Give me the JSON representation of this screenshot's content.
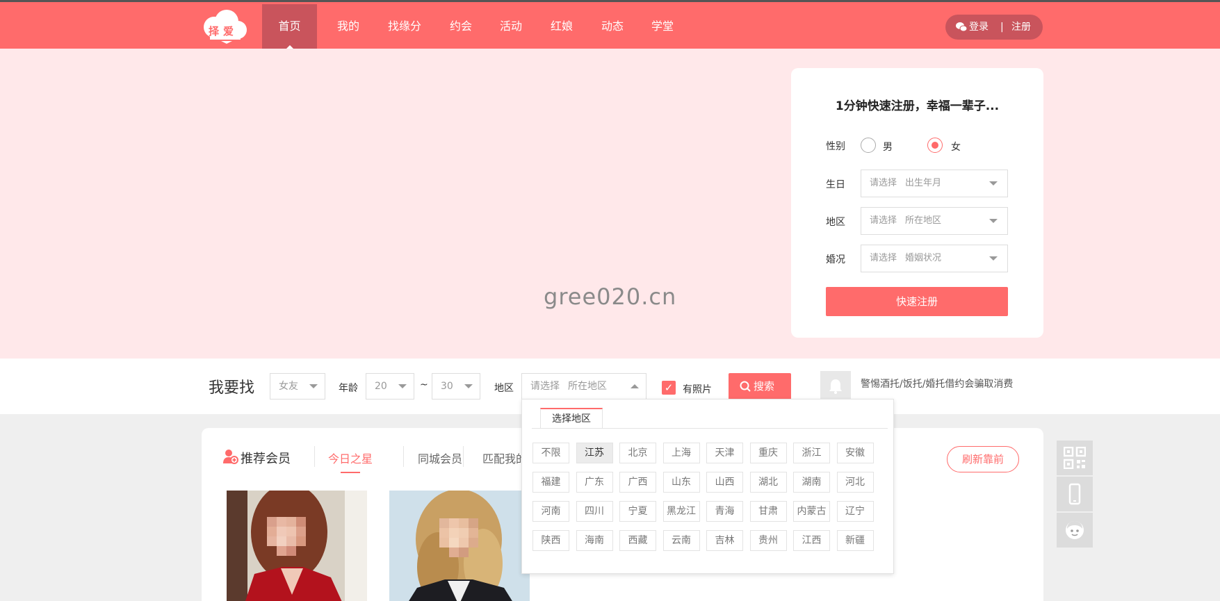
{
  "nav": {
    "logo_text": "择爱",
    "items": [
      {
        "label": "首页",
        "active": true
      },
      {
        "label": "我的"
      },
      {
        "label": "找缘分"
      },
      {
        "label": "约会"
      },
      {
        "label": "活动"
      },
      {
        "label": "红娘"
      },
      {
        "label": "动态"
      },
      {
        "label": "学堂"
      }
    ],
    "login": "登录",
    "separator": "|",
    "register": "注册"
  },
  "banner": {
    "watermark": "gree020.cn"
  },
  "register_card": {
    "title": "1分钟快速注册，幸福一辈子...",
    "gender_label": "性别",
    "gender_options": [
      "男",
      "女"
    ],
    "gender_selected": "女",
    "birthday_label": "生日",
    "birthday_placeholder": "请选择",
    "birthday_hint": "出生年月",
    "region_label": "地区",
    "region_placeholder": "请选择",
    "region_hint": "所在地区",
    "marital_label": "婚况",
    "marital_placeholder": "请选择",
    "marital_hint": "婚姻状况",
    "submit": "快速注册"
  },
  "search": {
    "title": "我要找",
    "target_value": "女友",
    "age_label": "年龄",
    "age_min": "20",
    "age_tilde": "~",
    "age_max": "30",
    "region_label": "地区",
    "region_placeholder": "请选择",
    "region_hint": "所在地区",
    "has_photo_label": "有照片",
    "has_photo_checked": true,
    "search_button": "搜索",
    "warning": "警惕酒托/饭托/婚托借约会骗取消费"
  },
  "members": {
    "title": "推荐会员",
    "tabs": [
      {
        "label": "今日之星",
        "active": true
      },
      {
        "label": "同城会员"
      },
      {
        "label": "匹配我的"
      }
    ],
    "refresh": "刷新靠前"
  },
  "region_dropdown": {
    "tab_label": "选择地区",
    "selected": "江苏",
    "provinces": [
      "不限",
      "江苏",
      "北京",
      "上海",
      "天津",
      "重庆",
      "浙江",
      "安徽",
      "福建",
      "广东",
      "广西",
      "山东",
      "山西",
      "湖北",
      "湖南",
      "河北",
      "河南",
      "四川",
      "宁夏",
      "黑龙江",
      "青海",
      "甘肃",
      "内蒙古",
      "辽宁",
      "陕西",
      "海南",
      "西藏",
      "云南",
      "吉林",
      "贵州",
      "江西",
      "新疆"
    ]
  },
  "colors": {
    "brand": "#ff6b6b",
    "nav_active": "#c9545c",
    "banner_bg": "#ffe8ea"
  }
}
